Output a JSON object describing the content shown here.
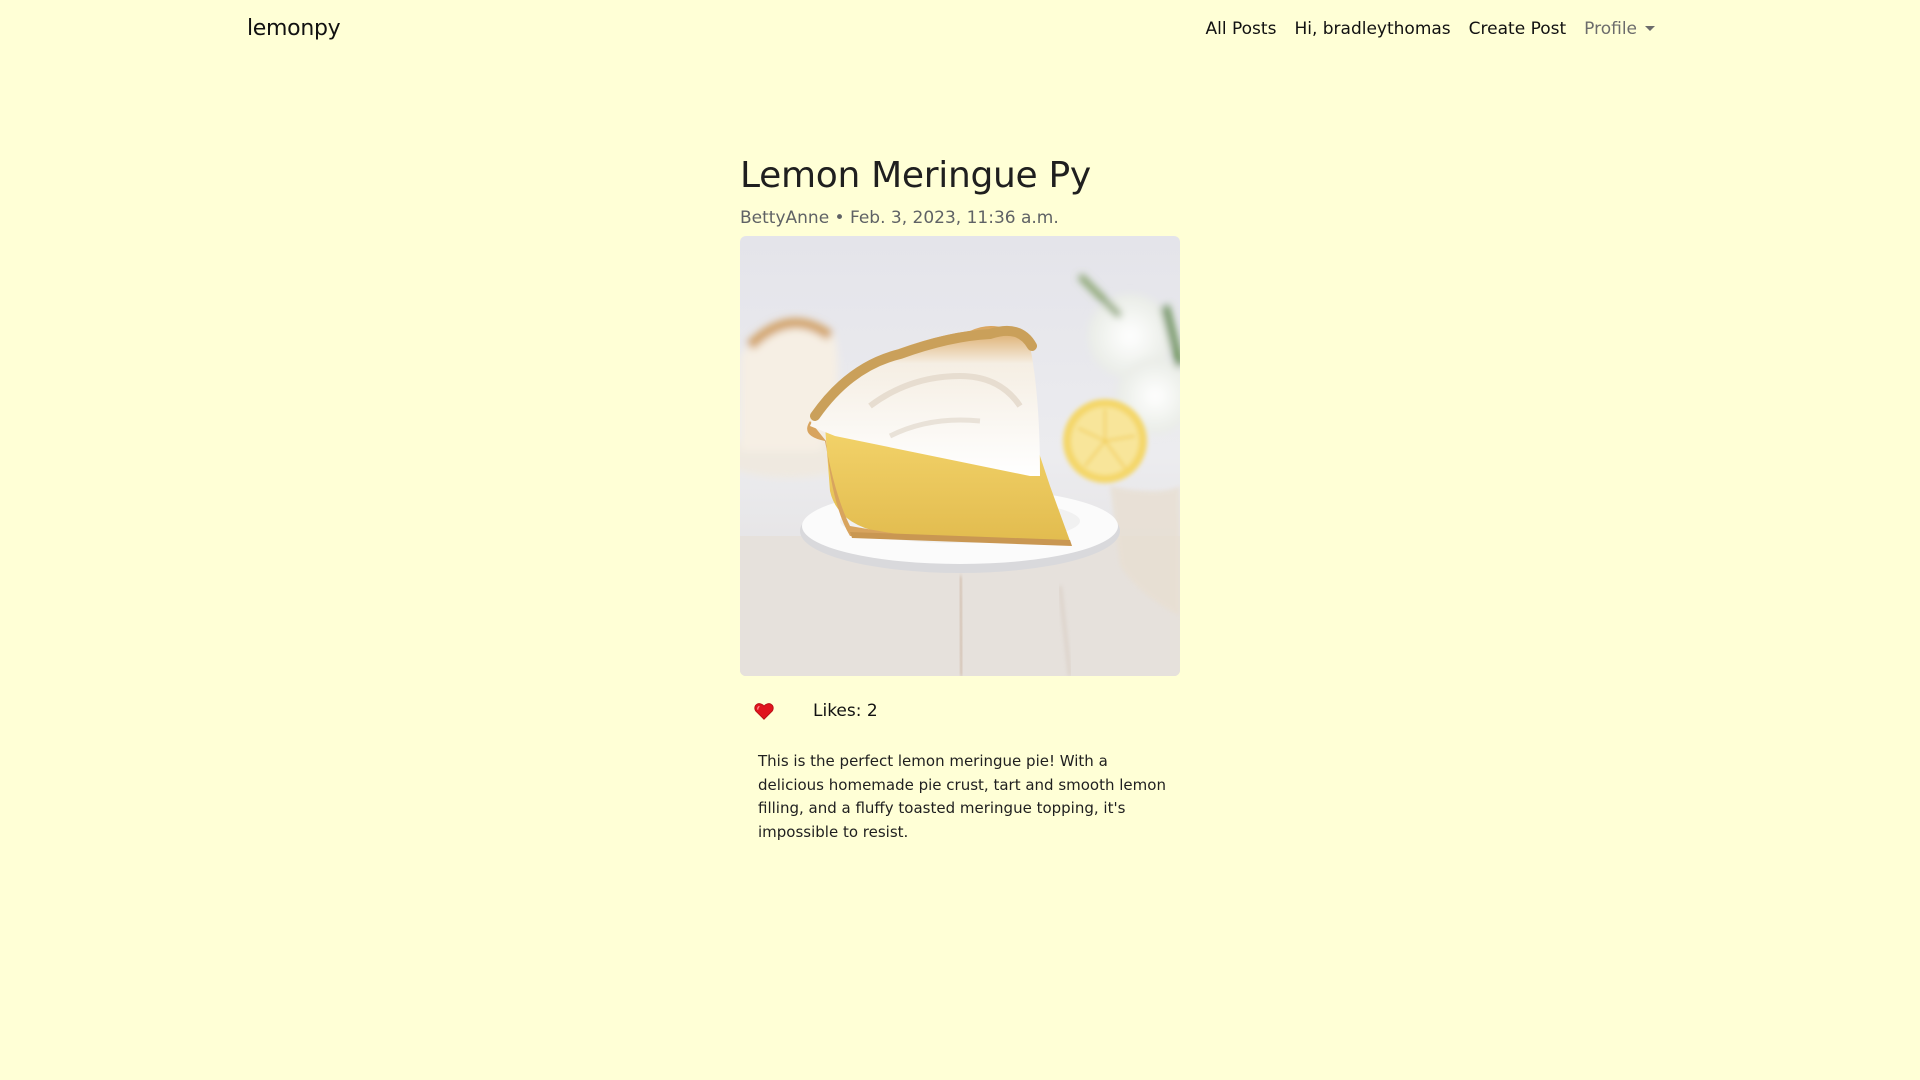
{
  "nav": {
    "brand": "lemonpy",
    "links": {
      "all_posts": "All Posts",
      "greeting": "Hi, bradleythomas",
      "create_post": "Create Post",
      "profile": "Profile"
    }
  },
  "post": {
    "title": "Lemon Meringue Py",
    "meta": "BettyAnne • Feb. 3, 2023, 11:36 a.m.",
    "image_alt": "lemon meringue pie slice photo",
    "likes": "Likes: 2",
    "body": "This is the perfect lemon meringue pie! With a delicious homemade pie crust, tart and smooth lemon filling, and a fluffy toasted meringue topping, it's impossible to resist."
  },
  "icons": {
    "like": "heart-icon",
    "profile_dropdown": "chevron-down-icon"
  },
  "colors": {
    "background": "#ffffd6",
    "heart": "#e0141e"
  }
}
